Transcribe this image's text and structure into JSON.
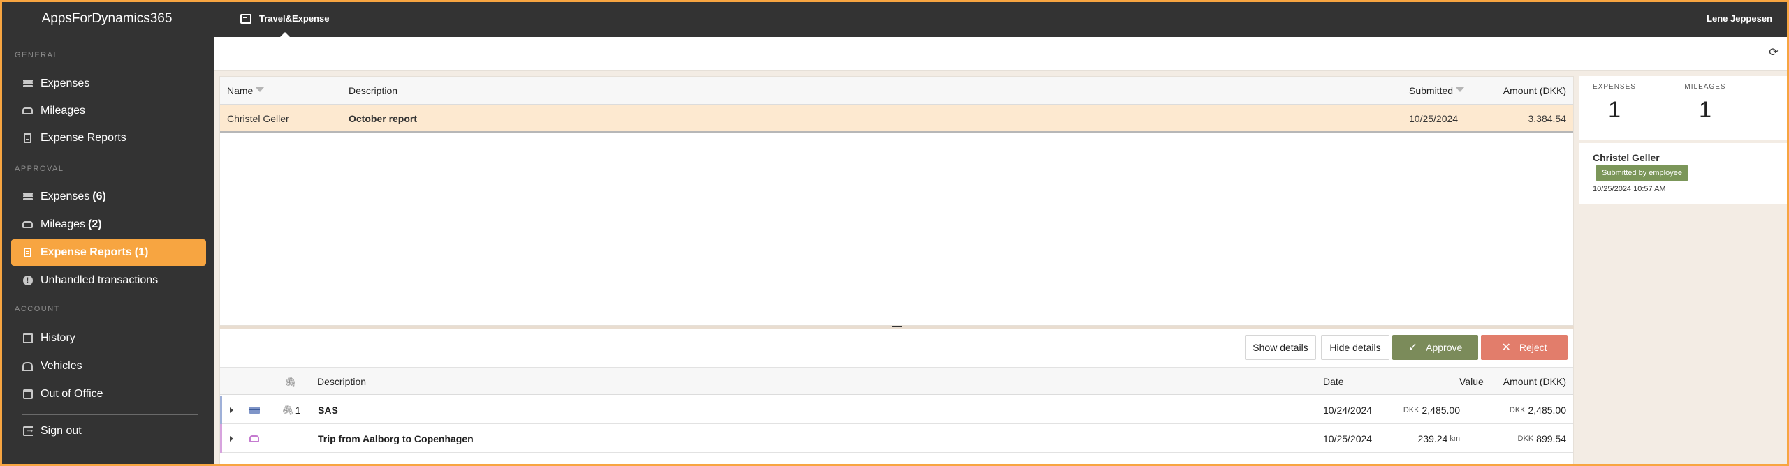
{
  "app": {
    "brand": "AppsForDynamics365",
    "active_tab": "Travel&Expense",
    "user": "Lene Jeppesen"
  },
  "sidebar": {
    "sections": {
      "general": "GENERAL",
      "approval": "APPROVAL",
      "account": "ACCOUNT"
    },
    "general_items": [
      {
        "label": "Expenses",
        "icon": "expenses-icon"
      },
      {
        "label": "Mileages",
        "icon": "car-icon"
      },
      {
        "label": "Expense Reports",
        "icon": "document-icon"
      }
    ],
    "approval_items": [
      {
        "label": "Expenses",
        "count": "(6)",
        "icon": "expenses-icon"
      },
      {
        "label": "Mileages",
        "count": "(2)",
        "icon": "car-icon"
      },
      {
        "label": "Expense Reports",
        "count": "(1)",
        "icon": "document-icon",
        "active": true
      },
      {
        "label": "Unhandled transactions",
        "icon": "alert-icon"
      }
    ],
    "account_items": [
      {
        "label": "History",
        "icon": "history-icon"
      },
      {
        "label": "Vehicles",
        "icon": "garage-icon"
      },
      {
        "label": "Out of Office",
        "icon": "calendar-icon"
      }
    ],
    "sign_out": "Sign out"
  },
  "grid": {
    "columns": {
      "name": "Name",
      "description": "Description",
      "submitted": "Submitted",
      "amount": "Amount (DKK)"
    },
    "rows": [
      {
        "name": "Christel Geller",
        "description": "October report",
        "submitted": "10/25/2024",
        "amount": "3,384.54"
      }
    ]
  },
  "details": {
    "buttons": {
      "show_details": "Show details",
      "hide_details": "Hide details",
      "approve": "Approve",
      "reject": "Reject"
    },
    "columns": {
      "description": "Description",
      "date": "Date",
      "value": "Value",
      "amount": "Amount (DKK)"
    },
    "rows": [
      {
        "type_icon": "credit-card-icon",
        "attachments": "1",
        "description": "SAS",
        "date": "10/24/2024",
        "value_unit": "DKK",
        "value": "2,485.00",
        "amount_unit": "DKK",
        "amount": "2,485.00",
        "bar_color": "#9fb0d8"
      },
      {
        "type_icon": "car-icon",
        "attachments": "",
        "description": "Trip from Aalborg to Copenhagen",
        "date": "10/25/2024",
        "value": "239.24",
        "value_suffix": "km",
        "amount_unit": "DKK",
        "amount": "899.54",
        "bar_color": "#d7a3de"
      }
    ]
  },
  "summary": {
    "expenses_label": "EXPENSES",
    "expenses_value": "1",
    "mileages_label": "MILEAGES",
    "mileages_value": "1"
  },
  "activity": {
    "name": "Christel Geller",
    "badge": "Submitted by employee",
    "timestamp": "10/25/2024 10:57 AM"
  },
  "colors": {
    "accent": "#f7a541",
    "sidebar_bg": "#333333",
    "approve": "#7b8b5a",
    "reject": "#e27d6b",
    "selected_row": "#fde9d0",
    "badge": "#7b9659"
  }
}
